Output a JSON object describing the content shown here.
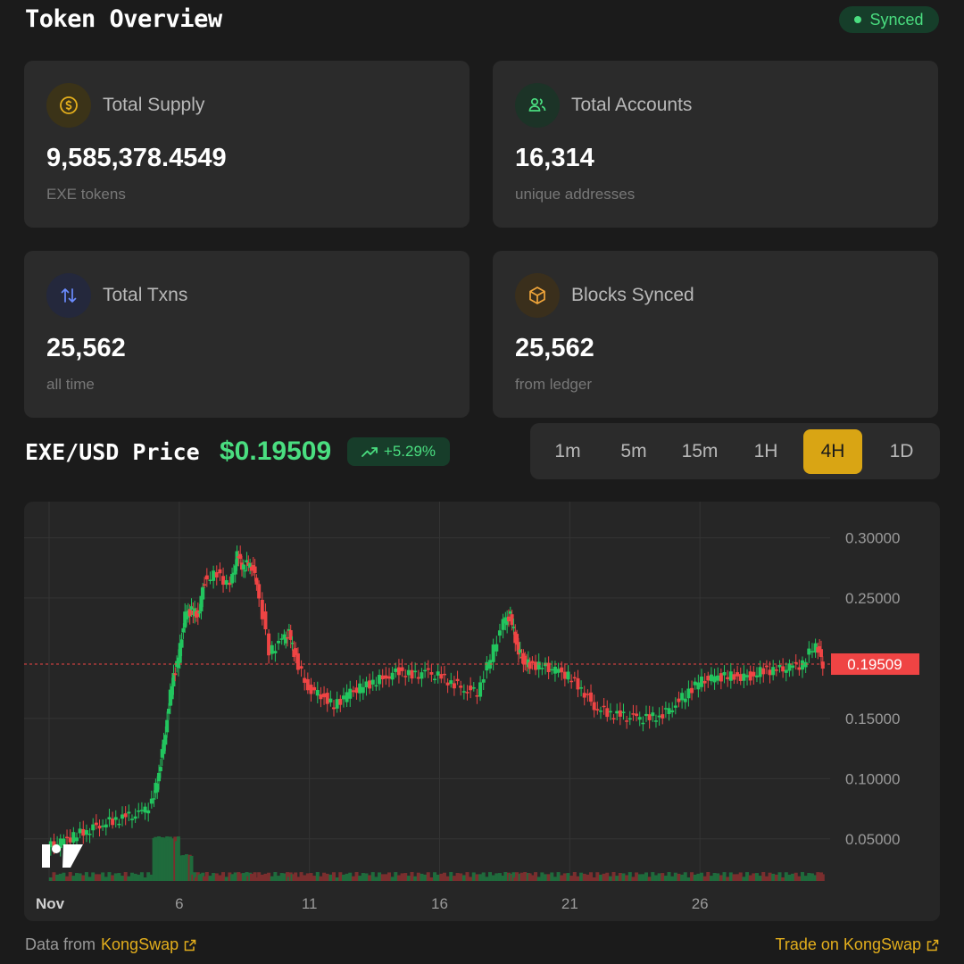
{
  "header": {
    "title": "Token Overview",
    "status": "Synced"
  },
  "colors": {
    "green": "#4ade80",
    "red": "#ef4444",
    "gold": "#e3ae1c",
    "accent_active": "#d9a514"
  },
  "cards": [
    {
      "icon": "dollar-icon",
      "label": "Total Supply",
      "value": "9,585,378.4549",
      "sub": "EXE tokens"
    },
    {
      "icon": "users-icon",
      "label": "Total Accounts",
      "value": "16,314",
      "sub": "unique addresses"
    },
    {
      "icon": "arrows-updown-icon",
      "label": "Total Txns",
      "value": "25,562",
      "sub": "all time"
    },
    {
      "icon": "cube-icon",
      "label": "Blocks Synced",
      "value": "25,562",
      "sub": "from ledger"
    }
  ],
  "price": {
    "pair": "EXE/USD Price",
    "value": "$0.19509",
    "change": "+5.29%"
  },
  "timeframes": [
    "1m",
    "5m",
    "15m",
    "1H",
    "4H",
    "1D"
  ],
  "active_timeframe": "4H",
  "footer": {
    "data_from_prefix": "Data from",
    "data_from_link": "KongSwap",
    "trade_link": "Trade on KongSwap"
  },
  "chart_data": {
    "type": "line",
    "title": "",
    "xlabel": "",
    "ylabel": "",
    "x_ticks": [
      "Nov",
      "6",
      "11",
      "16",
      "21",
      "26"
    ],
    "y_ticks": [
      "0.30000",
      "0.25000",
      "0.15000",
      "0.10000",
      "0.05000"
    ],
    "ylim": [
      0.015,
      0.33
    ],
    "current_price_label": "0.19509",
    "current_price": 0.19509,
    "grid": true,
    "series": [
      {
        "x": [
          0,
          0.5,
          1,
          1.5,
          2,
          2.5,
          3,
          3.5,
          4,
          4.25,
          4.5,
          4.75,
          5,
          5.25,
          5.5,
          5.75,
          6,
          6.5,
          7,
          7.25,
          7.5,
          7.75,
          8,
          8.5,
          9,
          9.25,
          9.5,
          10,
          10.5,
          11,
          11.5,
          12,
          12.5,
          13,
          13.5,
          14,
          14.5,
          15,
          15.5,
          16,
          16.5,
          17,
          17.5,
          17.75,
          18,
          18.25,
          18.5,
          19,
          19.5,
          20,
          20.5,
          21,
          21.5,
          22,
          22.5,
          23,
          23.5,
          24,
          24.5,
          25,
          25.5,
          26,
          26.5,
          27,
          27.5,
          28,
          28.5,
          29,
          29.5,
          29.75
        ],
        "y": [
          0.043,
          0.047,
          0.052,
          0.057,
          0.062,
          0.065,
          0.068,
          0.07,
          0.08,
          0.105,
          0.14,
          0.18,
          0.2,
          0.235,
          0.24,
          0.235,
          0.265,
          0.27,
          0.26,
          0.285,
          0.275,
          0.28,
          0.265,
          0.205,
          0.215,
          0.22,
          0.2,
          0.175,
          0.17,
          0.16,
          0.17,
          0.175,
          0.18,
          0.185,
          0.19,
          0.185,
          0.188,
          0.185,
          0.18,
          0.175,
          0.172,
          0.2,
          0.23,
          0.235,
          0.21,
          0.198,
          0.195,
          0.193,
          0.19,
          0.185,
          0.175,
          0.16,
          0.155,
          0.152,
          0.15,
          0.15,
          0.152,
          0.16,
          0.17,
          0.18,
          0.183,
          0.185,
          0.185,
          0.185,
          0.19,
          0.19,
          0.192,
          0.195,
          0.213,
          0.19509
        ]
      }
    ]
  }
}
